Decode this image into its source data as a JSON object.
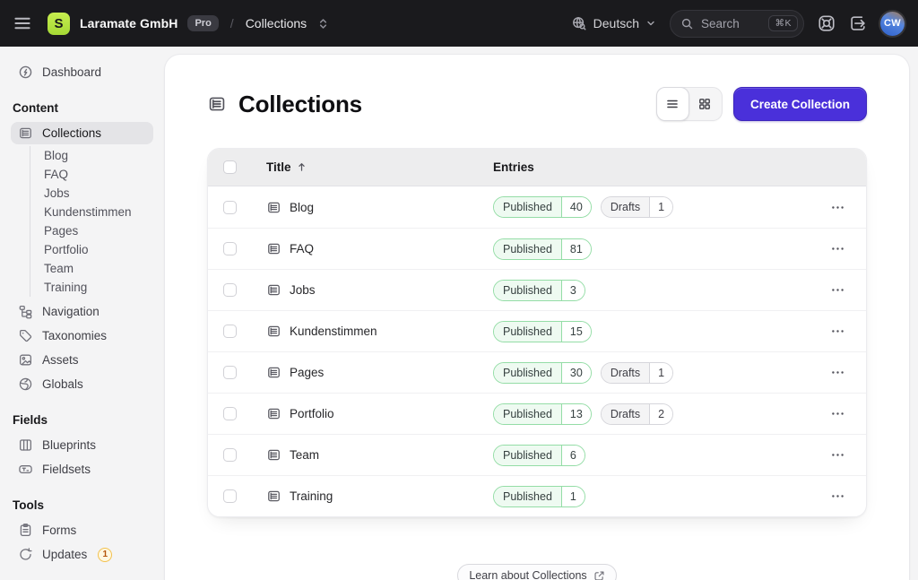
{
  "colors": {
    "accent": "#4a30da",
    "topbar_bg": "#1a1a1d",
    "logo_green": "#b8e243",
    "published_border": "#94dda6",
    "published_label_bg": "#eefaf1",
    "drafts_border": "#d6d6db",
    "drafts_label_bg": "#f4f4f5",
    "sidebar_bg": "#f4f4f5",
    "selected_item_bg": "#e4e4e7"
  },
  "topbar": {
    "logo_letter": "S",
    "site_name": "Laramate GmbH",
    "plan_badge": "Pro",
    "separator": "/",
    "breadcrumb": "Collections",
    "language": "Deutsch",
    "search_placeholder": "Search",
    "search_shortcut": "⌘K",
    "avatar_initials": "CW"
  },
  "sidebar": {
    "dashboard_label": "Dashboard",
    "sections": [
      {
        "title": "Content",
        "items": [
          {
            "label": "Collections",
            "icon": "collections",
            "active": true,
            "children": [
              "Blog",
              "FAQ",
              "Jobs",
              "Kundenstimmen",
              "Pages",
              "Portfolio",
              "Team",
              "Training"
            ]
          },
          {
            "label": "Navigation",
            "icon": "navigation"
          },
          {
            "label": "Taxonomies",
            "icon": "taxonomies"
          },
          {
            "label": "Assets",
            "icon": "assets"
          },
          {
            "label": "Globals",
            "icon": "globals"
          }
        ]
      },
      {
        "title": "Fields",
        "items": [
          {
            "label": "Blueprints",
            "icon": "blueprints"
          },
          {
            "label": "Fieldsets",
            "icon": "fieldsets"
          }
        ]
      },
      {
        "title": "Tools",
        "items": [
          {
            "label": "Forms",
            "icon": "forms"
          },
          {
            "label": "Updates",
            "icon": "updates",
            "badge": "1"
          }
        ]
      }
    ]
  },
  "main": {
    "page_title": "Collections",
    "create_button": "Create Collection",
    "footer_link": "Learn about Collections",
    "table": {
      "columns": {
        "title": "Title",
        "entries": "Entries"
      },
      "badge_labels": {
        "published": "Published",
        "drafts": "Drafts"
      },
      "rows": [
        {
          "title": "Blog",
          "published": 40,
          "drafts": 1
        },
        {
          "title": "FAQ",
          "published": 81
        },
        {
          "title": "Jobs",
          "published": 3
        },
        {
          "title": "Kundenstimmen",
          "published": 15
        },
        {
          "title": "Pages",
          "published": 30,
          "drafts": 1
        },
        {
          "title": "Portfolio",
          "published": 13,
          "drafts": 2
        },
        {
          "title": "Team",
          "published": 6
        },
        {
          "title": "Training",
          "published": 1
        }
      ]
    }
  }
}
